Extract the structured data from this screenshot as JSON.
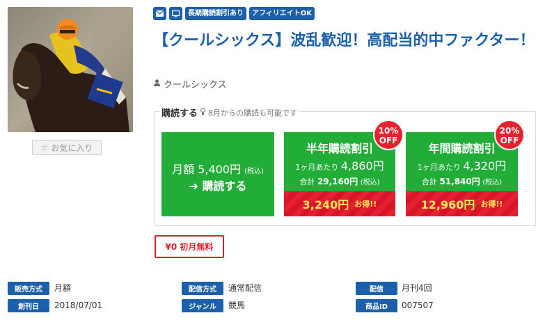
{
  "badges": {
    "mail_icon": "envelope-icon",
    "pc_icon": "monitor-icon",
    "long_term": "長期購読割引あり",
    "affiliate": "アフィリエイトOK"
  },
  "title": "【クールシックス】波乱歓迎！高配当的中ファクター！",
  "author": "クールシックス",
  "favorite_label": "お気に入り",
  "subscription": {
    "heading": "購読する",
    "note": "8月からの購読も可能です",
    "monthly": {
      "price": "月額 5,400円",
      "tax": "(税込)",
      "cta": "購読する"
    },
    "half_year": {
      "name": "半年購読割引",
      "discount_pct": "10%",
      "discount_off": "OFF",
      "per_month_label": "1ヶ月あたり",
      "per_month": "4,860円",
      "total_label": "合計",
      "total": "29,160円",
      "tax": "(税込)",
      "savings": "3,240円",
      "savings_word": "お得!!"
    },
    "year": {
      "name": "年間購読割引",
      "discount_pct": "20%",
      "discount_off": "OFF",
      "per_month_label": "1ヶ月あたり",
      "per_month": "4,320円",
      "total_label": "合計",
      "total": "51,840円",
      "tax": "(税込)",
      "savings": "12,960円",
      "savings_word": "お得!!"
    }
  },
  "free_first_month": "¥0 初月無料",
  "info": {
    "sales_type_label": "販売方式",
    "sales_type": "月額",
    "launch_label": "創刊日",
    "launch": "2018/07/01",
    "delivery_type_label": "配信方式",
    "delivery_type": "通常配信",
    "genre_label": "ジャンル",
    "genre": "競馬",
    "frequency_label": "配信",
    "frequency": "月刊4回",
    "product_id_label": "商品ID",
    "product_id": "007507"
  },
  "colors": {
    "brand_blue": "#1c5faa",
    "plan_green": "#22ac38",
    "accent_red": "#e62033",
    "savings_yellow": "#ffec5c"
  }
}
